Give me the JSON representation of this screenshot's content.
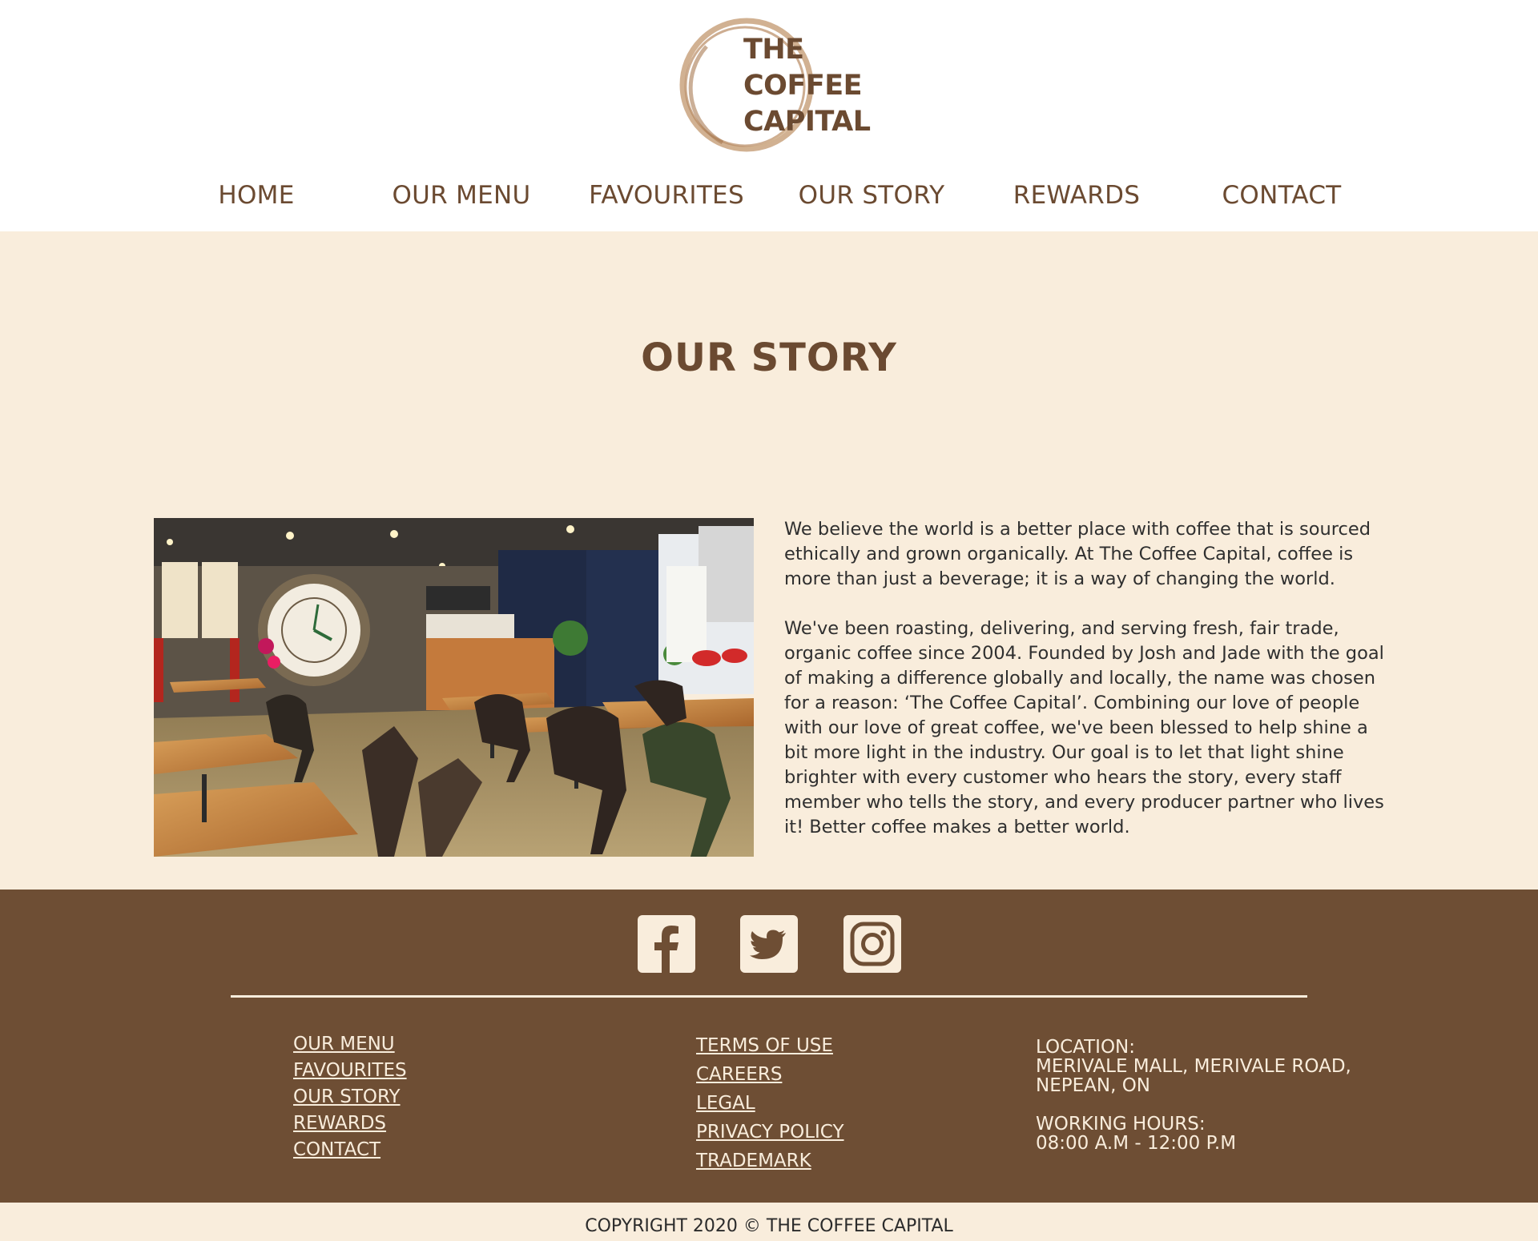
{
  "header": {
    "logo": {
      "line1": "THE",
      "line2": "COFFEE",
      "line3": "CAPITAL",
      "icon": "coffee-ring-stain-icon"
    },
    "nav": [
      {
        "label": "HOME"
      },
      {
        "label": "OUR MENU"
      },
      {
        "label": "FAVOURITES"
      },
      {
        "label": "OUR STORY"
      },
      {
        "label": "REWARDS"
      },
      {
        "label": "CONTACT"
      }
    ]
  },
  "main": {
    "title": "OUR STORY",
    "image": {
      "alt": "Interior of The Coffee Capital cafe with wooden tables, chairs and a large wall clock"
    },
    "paragraphs": [
      "We believe the world is a better place with coffee that is sourced ethically and grown organically. At The Coffee Capital, coffee is more than just a beverage; it is a way of changing the world.",
      "We've been roasting, delivering, and serving fresh, fair trade, organic coffee since 2004. Founded by Josh and Jade with the goal of making a difference globally and locally, the name was chosen for a reason: ‘The Coffee Capital’. Combining our love of people with our love of great coffee, we've been blessed to help shine a bit more light in the industry. Our goal is to let that light shine brighter with every customer who hears the story, every staff member who tells the story, and every producer partner who lives it! Better coffee makes a better world."
    ]
  },
  "footer": {
    "social": [
      {
        "icon": "facebook-icon"
      },
      {
        "icon": "twitter-icon"
      },
      {
        "icon": "instagram-icon"
      }
    ],
    "links_col1": [
      "OUR MENU",
      "FAVOURITES",
      "OUR STORY",
      "REWARDS",
      "CONTACT"
    ],
    "links_col2": [
      "TERMS OF USE",
      "CAREERS",
      "LEGAL",
      "PRIVACY POLICY",
      "TRADEMARK"
    ],
    "info": {
      "location_label": "LOCATION:",
      "location_line1": "MERIVALE MALL, MERIVALE ROAD,",
      "location_line2": "NEPEAN, ON",
      "hours_label": "WORKING HOURS:",
      "hours_value": "08:00 A.M - 12:00 P.M"
    },
    "copyright": "COPYRIGHT 2020 © THE COFFEE CAPITAL"
  },
  "colors": {
    "brand_brown": "#6e4e34",
    "heading_brown": "#6b4a31",
    "cream": "#f9eddc",
    "white": "#ffffff"
  }
}
